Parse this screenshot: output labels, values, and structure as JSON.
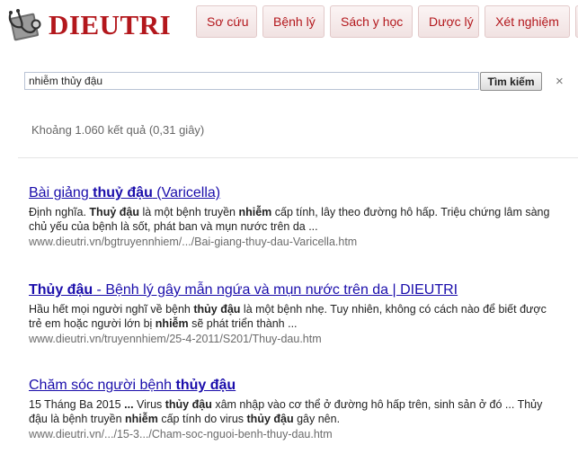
{
  "header": {
    "logo_text": "DIEUTRI",
    "brand_color": "#b3171c",
    "nav": [
      {
        "label": "Sơ cứu"
      },
      {
        "label": "Bệnh lý"
      },
      {
        "label": "Sách y học"
      },
      {
        "label": "Dược lý"
      },
      {
        "label": "Xét nghiệm"
      }
    ]
  },
  "search": {
    "query": "nhiễm thủy đậu",
    "button_label": "Tìm kiếm",
    "clear_icon": "×",
    "stats": "Khoảng 1.060 kết quả (0,31 giây)"
  },
  "results": [
    {
      "title": [
        {
          "text": "Bài giảng ",
          "bold": false
        },
        {
          "text": "thuỷ đậu",
          "bold": true
        },
        {
          "text": " (Varicella)",
          "bold": false
        }
      ],
      "snippet": [
        {
          "text": "Định nghĩa. ",
          "bold": false
        },
        {
          "text": "Thuỷ đậu",
          "bold": true
        },
        {
          "text": " là một bệnh truyền ",
          "bold": false
        },
        {
          "text": "nhiễm",
          "bold": true
        },
        {
          "text": " cấp tính, lây theo đường hô hấp. Triệu chứng lâm sàng chủ yếu của bệnh là sốt, phát ban và mụn nước trên da ...",
          "bold": false
        }
      ],
      "url": "www.dieutri.vn/bgtruyennhiem/.../Bai-giang-thuy-dau-Varicella.htm"
    },
    {
      "title": [
        {
          "text": "Thủy đậu",
          "bold": true
        },
        {
          "text": " - Bệnh lý gây mẫn ngứa và mụn nước trên da | DIEUTRI",
          "bold": false
        }
      ],
      "snippet": [
        {
          "text": "Hầu hết mọi người nghĩ về bệnh ",
          "bold": false
        },
        {
          "text": "thủy đậu",
          "bold": true
        },
        {
          "text": " là một bệnh nhẹ. Tuy nhiên, không có cách nào để biết được trẻ em hoặc người lớn bị ",
          "bold": false
        },
        {
          "text": "nhiễm",
          "bold": true
        },
        {
          "text": " sẽ phát triển thành ...",
          "bold": false
        }
      ],
      "url": "www.dieutri.vn/truyennhiem/25-4-2011/S201/Thuy-dau.htm"
    },
    {
      "title": [
        {
          "text": "Chăm sóc người bệnh ",
          "bold": false
        },
        {
          "text": "thủy đậu",
          "bold": true
        }
      ],
      "snippet": [
        {
          "text": "15 Tháng Ba 2015 ",
          "bold": false
        },
        {
          "text": "...",
          "bold": true
        },
        {
          "text": " Virus ",
          "bold": false
        },
        {
          "text": "thủy đậu",
          "bold": true
        },
        {
          "text": " xâm nhập vào cơ thể ở đường hô hấp trên, sinh sản ở đó ... Thủy đậu là bệnh truyền ",
          "bold": false
        },
        {
          "text": "nhiễm",
          "bold": true
        },
        {
          "text": " cấp tính do virus ",
          "bold": false
        },
        {
          "text": "thủy đậu",
          "bold": true
        },
        {
          "text": " gây nên.",
          "bold": false
        }
      ],
      "url": "www.dieutri.vn/.../15-3.../Cham-soc-nguoi-benh-thuy-dau.htm"
    }
  ]
}
